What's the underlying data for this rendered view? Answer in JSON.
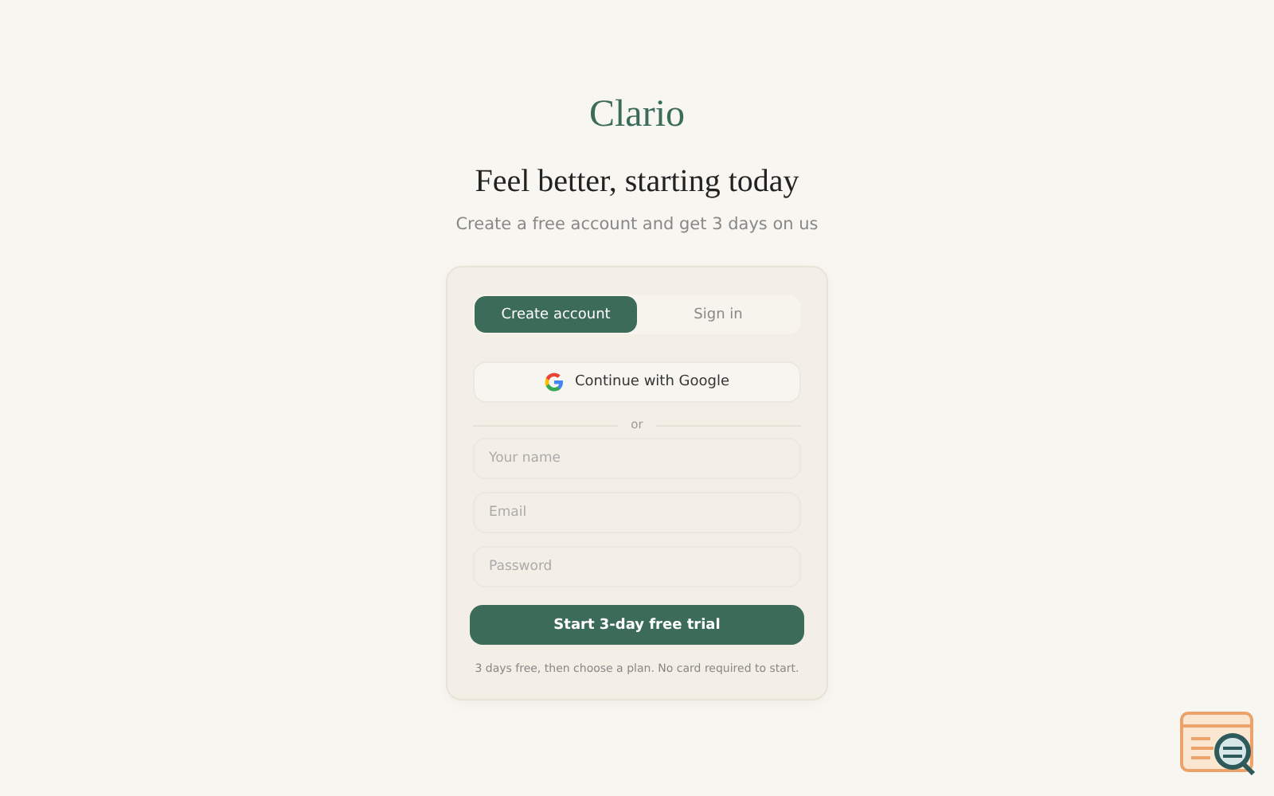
{
  "brand": "Clario",
  "heading": "Feel better, starting today",
  "subtitle": "Create a free account and get 3 days on us",
  "tabs": [
    {
      "label": "Create account",
      "selected": true
    },
    {
      "label": "Sign in",
      "selected": false
    }
  ],
  "google_button": "Continue with Google",
  "divider": "or",
  "fields": [
    {
      "placeholder": "Your name"
    },
    {
      "placeholder": "Email"
    },
    {
      "placeholder": "Password"
    }
  ],
  "submit": "Start 3-day free trial",
  "note": "3 days free, then choose a plan. No card required to start."
}
